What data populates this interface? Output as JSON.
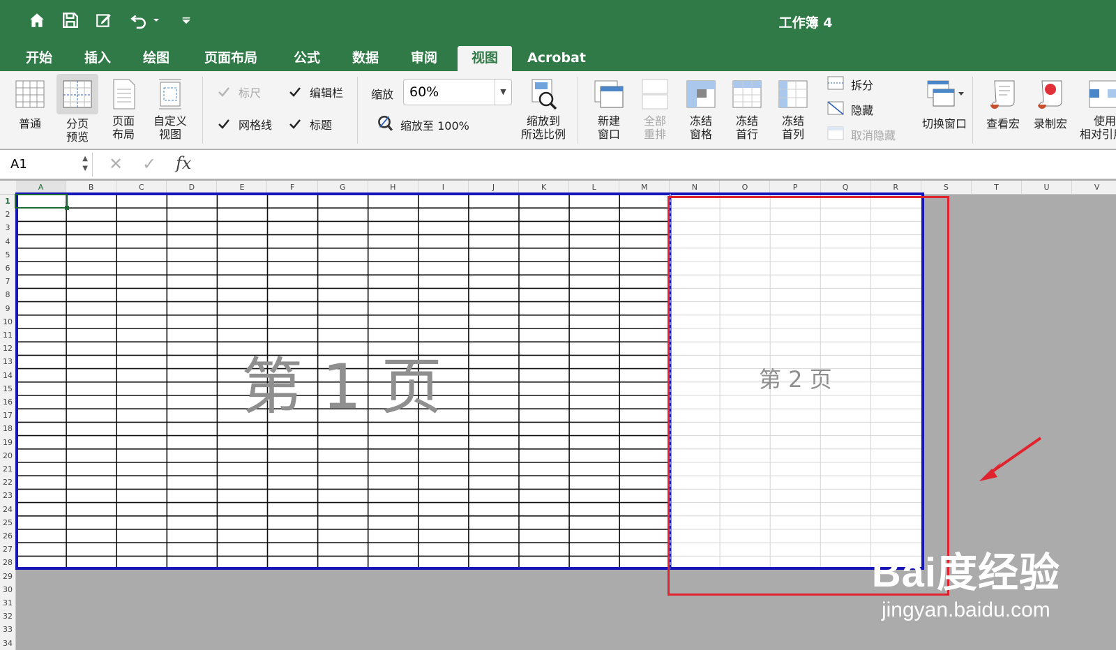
{
  "window": {
    "title": "工作簿 4"
  },
  "quick_access": [
    "home-icon",
    "save-icon",
    "edit-icon",
    "undo-icon",
    "customize-icon"
  ],
  "tabs": [
    {
      "label": "开始"
    },
    {
      "label": "插入"
    },
    {
      "label": "绘图"
    },
    {
      "label": "页面布局"
    },
    {
      "label": "公式"
    },
    {
      "label": "数据"
    },
    {
      "label": "审阅"
    },
    {
      "label": "视图"
    },
    {
      "label": "Acrobat"
    }
  ],
  "ribbon": {
    "views": {
      "normal": "普通",
      "pagebreak_l1": "分页",
      "pagebreak_l2": "预览",
      "pagelayout_l1": "页面",
      "pagelayout_l2": "布局",
      "custom_l1": "自定义",
      "custom_l2": "视图"
    },
    "show": {
      "ruler": "标尺",
      "formula_bar": "编辑栏",
      "gridlines": "网格线",
      "headings": "标题"
    },
    "zoom": {
      "label": "缩放",
      "value": "60%",
      "zoom100": "缩放至 100%",
      "fit_l1": "缩放到",
      "fit_l2": "所选比例"
    },
    "window": {
      "new_l1": "新建",
      "new_l2": "窗口",
      "arrange_l1": "全部",
      "arrange_l2": "重排",
      "freeze_l1": "冻结",
      "freeze_l2": "窗格",
      "freeze_row_l1": "冻结",
      "freeze_row_l2": "首行",
      "freeze_col_l1": "冻结",
      "freeze_col_l2": "首列",
      "split": "拆分",
      "hide": "隐藏",
      "unhide": "取消隐藏",
      "switch": "切换窗口"
    },
    "macros": {
      "view": "查看宏",
      "record": "录制宏",
      "relative_l1": "使用",
      "relative_l2": "相对引用"
    }
  },
  "formula_bar": {
    "cell_ref": "A1",
    "fx": "fx",
    "cancel": "✕",
    "enter": "✓"
  },
  "sheet": {
    "columns": [
      "A",
      "B",
      "C",
      "D",
      "E",
      "F",
      "G",
      "H",
      "I",
      "J",
      "K",
      "L",
      "M",
      "N",
      "O",
      "P",
      "Q",
      "R",
      "S",
      "T",
      "U",
      "V"
    ],
    "rows": [
      "1",
      "2",
      "3",
      "4",
      "5",
      "6",
      "7",
      "8",
      "9",
      "10",
      "11",
      "12",
      "13",
      "14",
      "15",
      "16",
      "17",
      "18",
      "19",
      "20",
      "21",
      "22",
      "23",
      "24",
      "25",
      "26",
      "27",
      "28",
      "29",
      "30",
      "31",
      "32",
      "33",
      "34"
    ],
    "page1_label": "第 1 页",
    "page2_label": "第 2 页",
    "page_border_color": "#1515b8",
    "highlight_color": "#e1232e"
  },
  "watermark": {
    "logo": "Bai度经验",
    "url": "jingyan.baidu.com"
  }
}
